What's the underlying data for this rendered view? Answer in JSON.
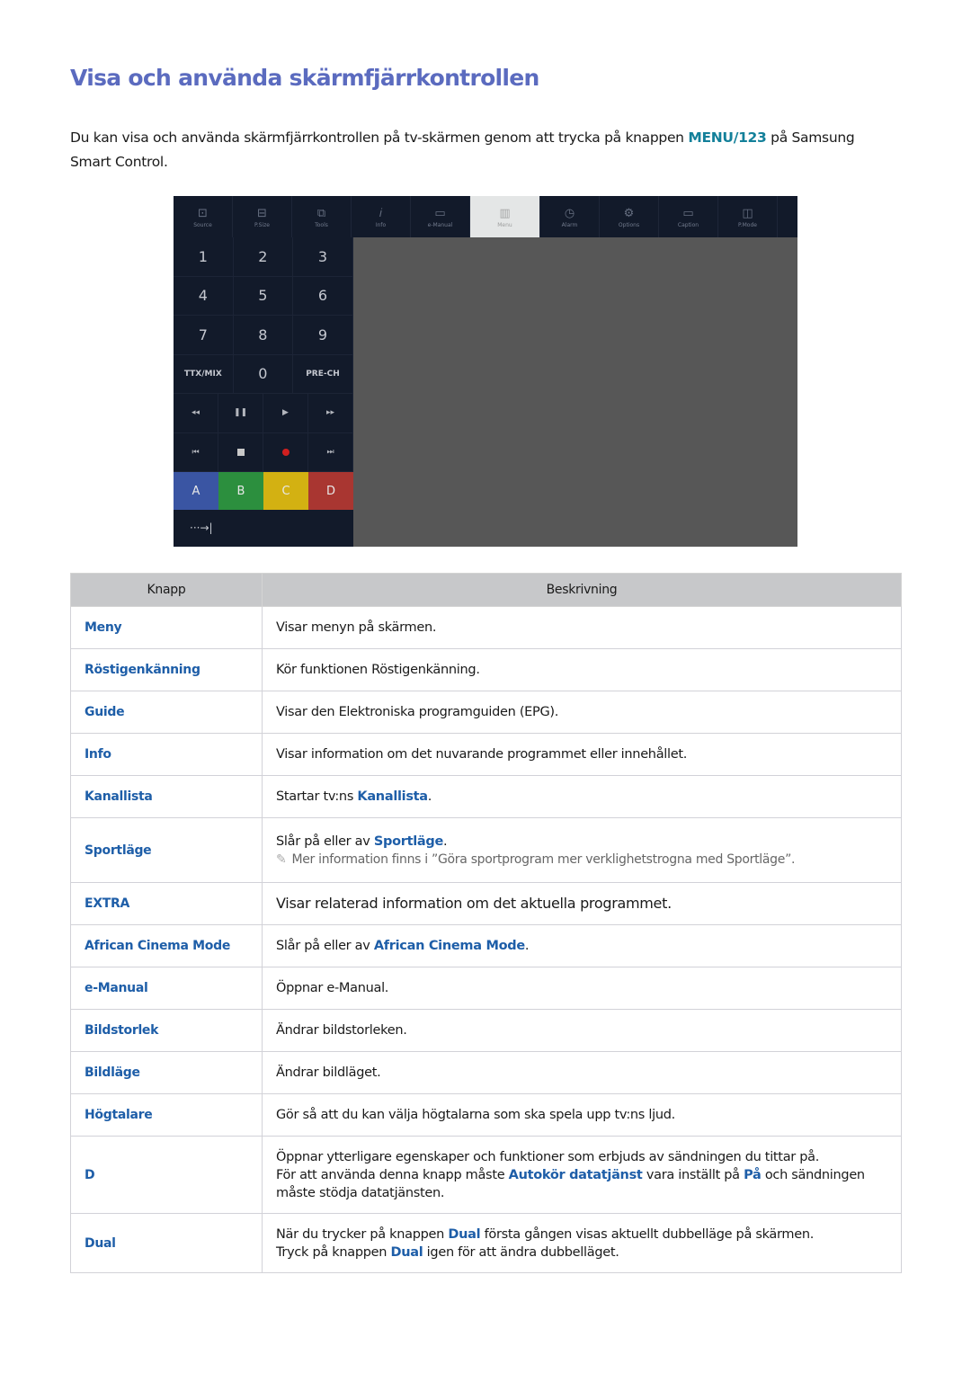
{
  "page": {
    "title": "Visa och använda skärmfjärrkontrollen",
    "intro_before": "Du kan visa och använda skärmfjärrkontrollen på tv-skärmen genom att trycka på knappen ",
    "intro_key": "MENU/123",
    "intro_after": " på Samsung Smart Control."
  },
  "remote": {
    "topbar": [
      {
        "label": "Source",
        "icon": "source-icon",
        "glyph": "⊡"
      },
      {
        "label": "P.Size",
        "icon": "picture-size-icon",
        "glyph": "⊟"
      },
      {
        "label": "Tools",
        "icon": "tools-icon",
        "glyph": "⧉"
      },
      {
        "label": "Info",
        "icon": "info-icon",
        "glyph": "𝑖"
      },
      {
        "label": "e-Manual",
        "icon": "e-manual-icon",
        "glyph": "▭"
      },
      {
        "label": "Menu",
        "icon": "menu-icon",
        "glyph": "▥",
        "active": true
      },
      {
        "label": "Alarm",
        "icon": "alarm-icon",
        "glyph": "◷"
      },
      {
        "label": "Options",
        "icon": "options-gear-icon",
        "glyph": "⚙"
      },
      {
        "label": "Caption",
        "icon": "caption-icon",
        "glyph": "▭"
      },
      {
        "label": "P.Mode",
        "icon": "picture-mode-icon",
        "glyph": "◫"
      }
    ],
    "numpad": [
      "1",
      "2",
      "3",
      "4",
      "5",
      "6",
      "7",
      "8",
      "9",
      "TTX/MIX",
      "0",
      "PRE-CH"
    ],
    "media": [
      {
        "name": "rewind-icon",
        "glyph": "◂◂"
      },
      {
        "name": "pause-icon",
        "glyph": "❚❚"
      },
      {
        "name": "play-icon",
        "glyph": "▶"
      },
      {
        "name": "fast-forward-icon",
        "glyph": "▸▸"
      },
      {
        "name": "skip-back-icon",
        "glyph": "⏮"
      },
      {
        "name": "stop-icon",
        "glyph": ""
      },
      {
        "name": "record-icon",
        "glyph": ""
      },
      {
        "name": "skip-forward-icon",
        "glyph": "⏭"
      }
    ],
    "color_keys": [
      {
        "label": "A",
        "color": "#3a55a3"
      },
      {
        "label": "B",
        "color": "#2c8f3e"
      },
      {
        "label": "C",
        "color": "#d3b112"
      },
      {
        "label": "D",
        "color": "#a93631"
      }
    ],
    "tab_key": "···→|"
  },
  "table": {
    "headers": [
      "Knapp",
      "Beskrivning"
    ],
    "rows": [
      {
        "key": "Meny",
        "desc": "Visar menyn på skärmen."
      },
      {
        "key": "Röstigenkänning",
        "desc": "Kör funktionen Röstigenkänning."
      },
      {
        "key": "Guide",
        "desc": "Visar den Elektroniska programguiden (EPG)."
      },
      {
        "key": "Info",
        "desc": "Visar information om det nuvarande programmet eller innehållet."
      },
      {
        "key": "Kanallista",
        "desc_pre": "Startar tv:ns ",
        "desc_b": "Kanallista",
        "desc_post": "."
      },
      {
        "key": "Sportläge",
        "desc_pre": "Slår på eller av ",
        "desc_b": "Sportläge",
        "desc_post": ".",
        "note": "Mer information finns i ”Göra sportprogram mer verklighetstrogna med Sportläge”."
      },
      {
        "key": "EXTRA",
        "desc": "Visar relaterad information om det aktuella programmet."
      },
      {
        "key": "African Cinema Mode",
        "desc_pre": "Slår på eller av ",
        "desc_b": "African Cinema Mode",
        "desc_post": "."
      },
      {
        "key": "e-Manual",
        "desc": "Öppnar e-Manual."
      },
      {
        "key": "Bildstorlek",
        "desc": "Ändrar bildstorleken."
      },
      {
        "key": "Bildläge",
        "desc": "Ändrar bildläget."
      },
      {
        "key": "Högtalare",
        "desc": "Gör så att du kan välja högtalarna som ska spela upp tv:ns ljud."
      },
      {
        "key": "D",
        "line1": "Öppnar ytterligare egenskaper och funktioner som erbjuds av sändningen du tittar på.",
        "line2_pre": "För att använda denna knapp måste ",
        "line2_b1": "Autokör datatjänst",
        "line2_mid": " vara inställt på ",
        "line2_b2": "På",
        "line2_post": " och sändningen måste stödja datatjänsten."
      },
      {
        "key": "Dual",
        "line1_pre": "När du trycker på knappen ",
        "line1_b": "Dual",
        "line1_post": " första gången visas aktuellt dubbelläge på skärmen.",
        "line2_pre": "Tryck på knappen ",
        "line2_b": "Dual",
        "line2_post": " igen för att ändra dubbelläget."
      }
    ]
  }
}
